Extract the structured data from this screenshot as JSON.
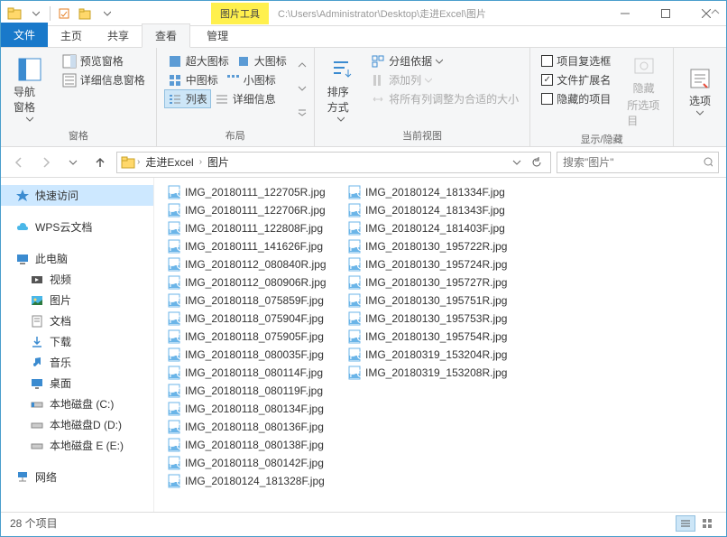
{
  "title_path": "C:\\Users\\Administrator\\Desktop\\走进Excel\\图片",
  "context_tab": "图片工具",
  "tabs": {
    "file": "文件",
    "home": "主页",
    "share": "共享",
    "view": "查看",
    "manage": "管理"
  },
  "ribbon": {
    "panes": {
      "label": "窗格",
      "nav": "导航窗格",
      "preview": "预览窗格",
      "details": "详细信息窗格"
    },
    "layout": {
      "label": "布局",
      "xl_icon": "超大图标",
      "l_icon": "大图标",
      "m_icon": "中图标",
      "s_icon": "小图标",
      "list": "列表",
      "detail": "详细信息"
    },
    "currentview": {
      "label": "当前视图",
      "sort": "排序方式",
      "group": "分组依据",
      "addcol": "添加列",
      "fitcol": "将所有列调整为合适的大小"
    },
    "showhide": {
      "label": "显示/隐藏",
      "itemchk": "项目复选框",
      "ext": "文件扩展名",
      "hidden": "隐藏的项目",
      "hidebtn": "隐藏",
      "hidebtn2": "所选项目"
    },
    "options": "选项"
  },
  "breadcrumb": [
    "走进Excel",
    "图片"
  ],
  "search_placeholder": "搜索\"图片\"",
  "nav": {
    "quick": "快速访问",
    "wps": "WPS云文档",
    "pc": "此电脑",
    "video": "视频",
    "pictures": "图片",
    "docs": "文档",
    "downloads": "下载",
    "music": "音乐",
    "desktop": "桌面",
    "drive_c": "本地磁盘 (C:)",
    "drive_d": "本地磁盘D (D:)",
    "drive_e": "本地磁盘 E (E:)",
    "network": "网络"
  },
  "files": [
    "IMG_20180111_122705R.jpg",
    "IMG_20180111_122706R.jpg",
    "IMG_20180111_122808F.jpg",
    "IMG_20180111_141626F.jpg",
    "IMG_20180112_080840R.jpg",
    "IMG_20180112_080906R.jpg",
    "IMG_20180118_075859F.jpg",
    "IMG_20180118_075904F.jpg",
    "IMG_20180118_075905F.jpg",
    "IMG_20180118_080035F.jpg",
    "IMG_20180118_080114F.jpg",
    "IMG_20180118_080119F.jpg",
    "IMG_20180118_080134F.jpg",
    "IMG_20180118_080136F.jpg",
    "IMG_20180118_080138F.jpg",
    "IMG_20180118_080142F.jpg",
    "IMG_20180124_181328F.jpg",
    "IMG_20180124_181334F.jpg",
    "IMG_20180124_181343F.jpg",
    "IMG_20180124_181403F.jpg",
    "IMG_20180130_195722R.jpg",
    "IMG_20180130_195724R.jpg",
    "IMG_20180130_195727R.jpg",
    "IMG_20180130_195751R.jpg",
    "IMG_20180130_195753R.jpg",
    "IMG_20180130_195754R.jpg",
    "IMG_20180319_153204R.jpg",
    "IMG_20180319_153208R.jpg"
  ],
  "status": "28 个项目"
}
